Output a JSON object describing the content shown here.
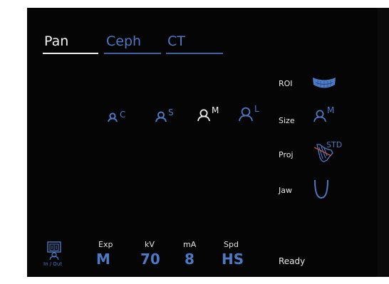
{
  "tabs": [
    {
      "label": "Pan",
      "active": true
    },
    {
      "label": "Ceph",
      "active": false
    },
    {
      "label": "CT",
      "active": false
    }
  ],
  "patient_sizes": [
    {
      "superscript": "C",
      "selected": false
    },
    {
      "superscript": "S",
      "selected": false
    },
    {
      "superscript": "M",
      "selected": true
    },
    {
      "superscript": "L",
      "selected": false
    }
  ],
  "settings": {
    "roi": {
      "label": "ROI",
      "icon": "arch-roi-icon"
    },
    "size": {
      "label": "Size",
      "icon": "patient-medium-icon",
      "value": "M"
    },
    "proj": {
      "label": "Proj",
      "icon": "projection-icon",
      "value": "STD"
    },
    "jaw": {
      "label": "Jaw",
      "icon": "jaw-curve-icon"
    }
  },
  "params": {
    "exp": {
      "label": "Exp",
      "value": "M"
    },
    "kv": {
      "label": "kV",
      "value": "70"
    },
    "ma": {
      "label": "mA",
      "value": "8"
    },
    "spd": {
      "label": "Spd",
      "value": "HS"
    }
  },
  "in_out": {
    "label": "In / Out",
    "icon": "in-out-icon"
  },
  "status": "Ready",
  "colors": {
    "accent": "#4e79c4",
    "active": "#f2f2f2",
    "background": "#050505",
    "proj_highlight": "#c0524a"
  }
}
